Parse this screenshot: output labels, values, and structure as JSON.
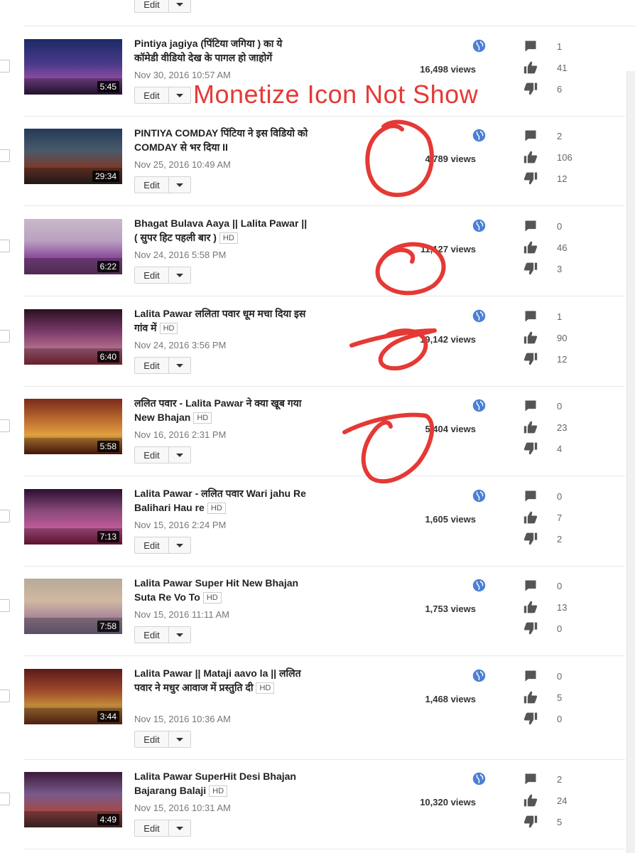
{
  "edit_label": "Edit",
  "annotation_text": "Monetize Icon Not Show",
  "hd_label": "HD",
  "colors": {
    "annotation": "#e53935",
    "globe": "#4a7fd4",
    "icon": "#555555"
  },
  "videos": [
    {
      "title": "Pintiya jagiya (पिंटिया जगिया ) का ये कॉमेडी वीडियो देख के पागल हो जाहोगें",
      "hd": false,
      "date": "Nov 30, 2016 10:57 AM",
      "duration": "5:45",
      "views": "16,498 views",
      "comments": "1",
      "likes": "41",
      "dislikes": "6"
    },
    {
      "title": "PINTIYA COMDAY पिंटिया ने इस विडियो को COMDAY से भर दिया II",
      "hd": false,
      "date": "Nov 25, 2016 10:49 AM",
      "duration": "29:34",
      "views": "4,789 views",
      "comments": "2",
      "likes": "106",
      "dislikes": "12"
    },
    {
      "title": "Bhagat Bulava Aaya || Lalita Pawar || ( सुपर हिट पहली बार )",
      "hd": true,
      "date": "Nov 24, 2016 5:58 PM",
      "duration": "6:22",
      "views": "11,127 views",
      "comments": "0",
      "likes": "46",
      "dislikes": "3"
    },
    {
      "title": "Lalita Pawar ललिता पवार धूम मचा दिया इस गांव में",
      "hd": true,
      "date": "Nov 24, 2016 3:56 PM",
      "duration": "6:40",
      "views": "19,142 views",
      "comments": "1",
      "likes": "90",
      "dislikes": "12"
    },
    {
      "title": "ललित पवार - Lalita Pawar ने क्या खूब गया New Bhajan",
      "hd": true,
      "date": "Nov 16, 2016 2:31 PM",
      "duration": "5:58",
      "views": "5,404 views",
      "comments": "0",
      "likes": "23",
      "dislikes": "4"
    },
    {
      "title": "Lalita Pawar - ललित पवार Wari jahu Re Balihari Hau re",
      "hd": true,
      "date": "Nov 15, 2016 2:24 PM",
      "duration": "7:13",
      "views": "1,605 views",
      "comments": "0",
      "likes": "7",
      "dislikes": "2"
    },
    {
      "title": "Lalita Pawar Super Hit New Bhajan Suta Re Vo To",
      "hd": true,
      "date": "Nov 15, 2016 11:11 AM",
      "duration": "7:58",
      "views": "1,753 views",
      "comments": "0",
      "likes": "13",
      "dislikes": "0"
    },
    {
      "title": "Lalita Pawar || Mataji aavo la || ललित पवार ने मधुर आवाज में प्रस्तुति दी",
      "hd": true,
      "date": "Nov 15, 2016 10:36 AM",
      "duration": "3:44",
      "views": "1,468 views",
      "comments": "0",
      "likes": "5",
      "dislikes": "0"
    },
    {
      "title": "Lalita Pawar SuperHit Desi Bhajan Bajarang Balaji",
      "hd": true,
      "date": "Nov 15, 2016 10:31 AM",
      "duration": "4:49",
      "views": "10,320 views",
      "comments": "2",
      "likes": "24",
      "dislikes": "5"
    }
  ]
}
